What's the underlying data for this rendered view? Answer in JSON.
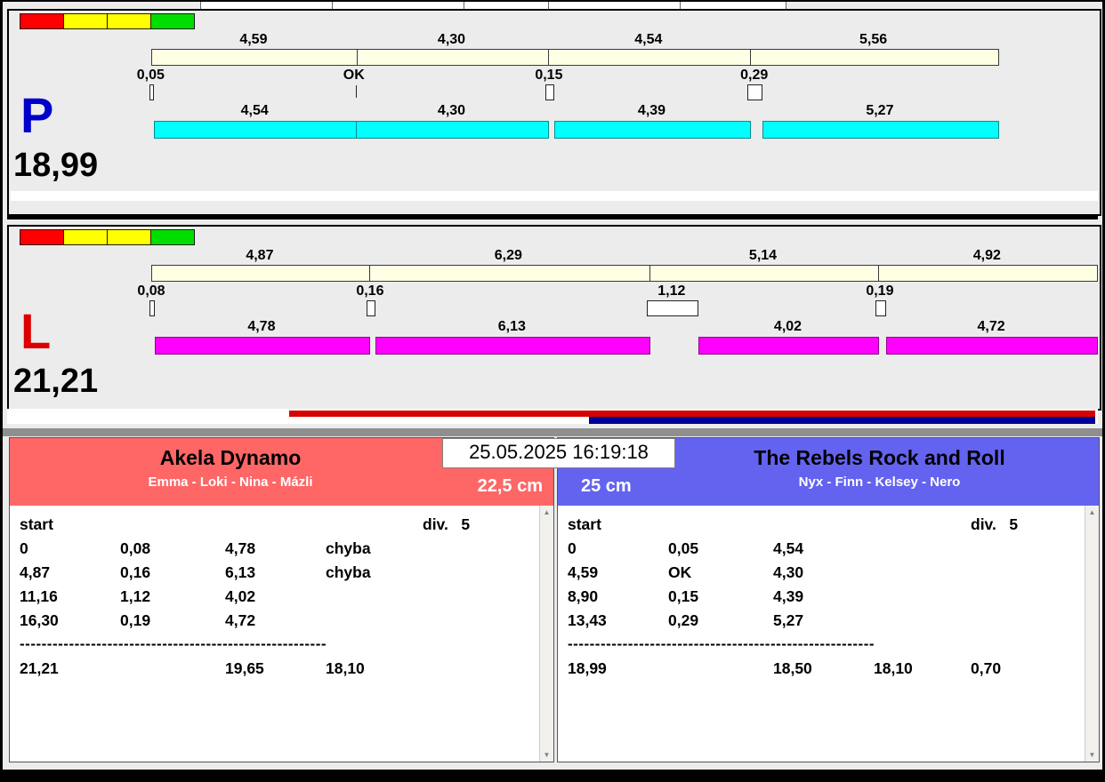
{
  "timestamp": "25.05.2025 16:19:18",
  "status_lights": [
    "#ff0000",
    "#ffff00",
    "#ffff00",
    "#00dd00"
  ],
  "icons": {
    "scroll_up": "▲",
    "scroll_down": "▼"
  },
  "lanes": [
    {
      "letter": "P",
      "letter_color": "#0000cc",
      "total": "18,99",
      "splits": [
        "4,59",
        "4,30",
        "4,54",
        "5,56"
      ],
      "markers": [
        "0,05",
        "OK",
        "0,15",
        "0,29"
      ],
      "clean_times": [
        "4,54",
        "4,30",
        "4,39",
        "5,27"
      ],
      "bar_color": "#00ffff"
    },
    {
      "letter": "L",
      "letter_color": "#dd0000",
      "total": "21,21",
      "splits": [
        "4,87",
        "6,29",
        "5,14",
        "4,92"
      ],
      "markers": [
        "0,08",
        "0,16",
        "1,12",
        "0,19"
      ],
      "clean_times": [
        "4,78",
        "6,13",
        "4,02",
        "4,72"
      ],
      "bar_color": "#ff00ff"
    }
  ],
  "progress_bars": [
    {
      "label": "red-progress",
      "color": "#d80000",
      "left_frac": 0.2586
    },
    {
      "label": "navy-progress",
      "color": "#000099",
      "left_frac": 0.5334
    }
  ],
  "teams": [
    {
      "name": "Akela Dynamo",
      "members": "Emma - Loki - Nina - Mázli",
      "height": "22,5 cm",
      "header_color": "#ff6666",
      "table": {
        "rows": [
          [
            "start",
            "",
            "",
            "",
            "div.   5"
          ],
          [
            "0",
            "0,08",
            "4,78",
            "chyba",
            ""
          ],
          [
            "4,87",
            "0,16",
            "6,13",
            "chyba",
            ""
          ],
          [
            "11,16",
            "1,12",
            "4,02",
            "",
            ""
          ],
          [
            "16,30",
            "0,19",
            "4,72",
            "",
            ""
          ]
        ],
        "separator": "--------------------------------------------------------",
        "totals": [
          "21,21",
          "",
          "19,65",
          "18,10",
          ""
        ]
      }
    },
    {
      "name": "The Rebels Rock and Roll",
      "members": "Nyx - Finn - Kelsey - Nero",
      "height": "25 cm",
      "header_color": "#6363f0",
      "table": {
        "rows": [
          [
            "start",
            "",
            "",
            "",
            "div.   5"
          ],
          [
            "0",
            "0,05",
            "4,54",
            "",
            ""
          ],
          [
            "4,59",
            "OK",
            "4,30",
            "",
            ""
          ],
          [
            "8,90",
            "0,15",
            "4,39",
            "",
            ""
          ],
          [
            "13,43",
            "0,29",
            "5,27",
            "",
            ""
          ]
        ],
        "separator": "--------------------------------------------------------",
        "totals": [
          "18,99",
          "",
          "18,50",
          "18,10",
          "0,70"
        ]
      }
    }
  ]
}
